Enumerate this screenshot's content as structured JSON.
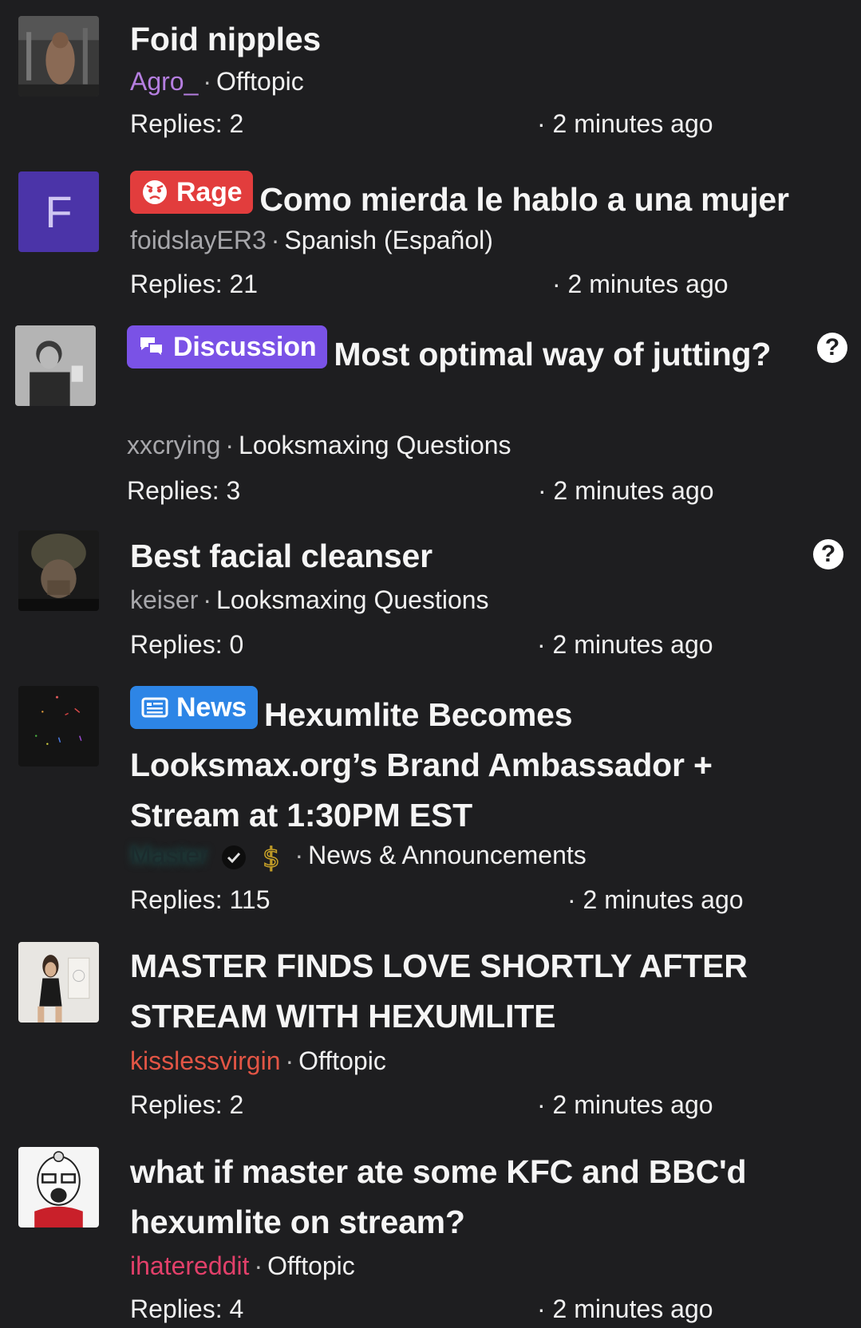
{
  "threads": [
    {
      "title": "Foid nipples",
      "prefix": "",
      "author": "Agro_",
      "author_color": "#b57ee0",
      "forum": "Offtopic",
      "replies_label": "Replies: 2",
      "time_label": "· 2 minutes ago"
    },
    {
      "title": "Como mierda le hablo a una mujer",
      "prefix": "Rage",
      "avatar_letter": "F",
      "author": "foidslayER3",
      "author_color": "#a7a7ab",
      "forum": "Spanish (Español)",
      "replies_label": "Replies: 21",
      "time_label": "· 2 minutes ago"
    },
    {
      "title": "Most optimal way of jutting?",
      "prefix": "Discussion",
      "author": "xxcrying",
      "author_color": "#a7a7ab",
      "forum": "Looksmaxing Questions",
      "replies_label": "Replies: 3",
      "time_label": "· 2 minutes ago",
      "help_icon": "?"
    },
    {
      "title": "Best facial cleanser",
      "prefix": "",
      "author": "keiser",
      "author_color": "#a7a7ab",
      "forum": "Looksmaxing Questions",
      "replies_label": "Replies: 0",
      "time_label": "· 2 minutes ago",
      "help_icon": "?"
    },
    {
      "title": "Hexumlite Becomes Looksmax.org’s Brand Ambassador + Stream at 1:30PM EST",
      "prefix": "News",
      "author": "Master",
      "author_color": "#1b2a2c",
      "forum": "News & Announcements",
      "replies_label": "Replies: 115",
      "time_label": "· 2 minutes ago"
    },
    {
      "title": "MASTER FINDS LOVE SHORTLY AFTER STREAM WITH HEXUMLITE",
      "prefix": "",
      "author": "kisslessvirgin",
      "author_color": "#e25545",
      "forum": "Offtopic",
      "replies_label": "Replies: 2",
      "time_label": "· 2 minutes ago"
    },
    {
      "title": "what if master ate some KFC and BBC'd hexumlite on stream?",
      "prefix": "",
      "author": "ihatereddit",
      "author_color": "#e2406a",
      "forum": "Offtopic",
      "replies_label": "Replies: 4",
      "time_label": "· 2 minutes ago"
    }
  ],
  "icons": {
    "rage": "angry-face-icon",
    "discussion": "chat-bubbles-icon",
    "news": "newspaper-icon",
    "verified": "verified-check-icon",
    "dollar": "dollar-icon",
    "help": "question-mark-icon"
  }
}
